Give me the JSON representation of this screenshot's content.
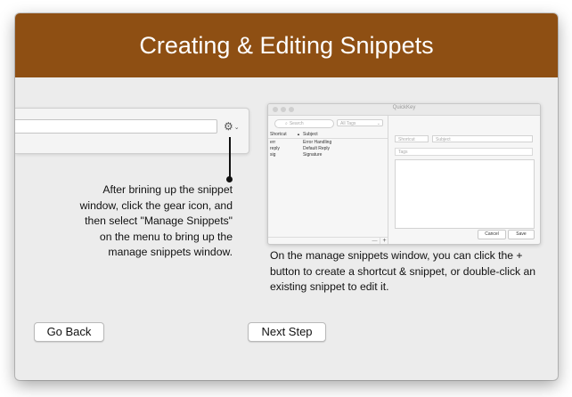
{
  "header": {
    "title": "Creating & Editing Snippets"
  },
  "left_panel": {
    "gear_icon": "gear-icon",
    "caption": "After brining up the snippet window, click the gear icon, and then select \"Manage Snippets\" on the menu to bring up the manage snippets window."
  },
  "thumbnail": {
    "window_title": "QuickKey",
    "search_placeholder": "Search",
    "tags_filter": "All Tags",
    "columns": {
      "shortcut": "Shortcut",
      "subject": "Subject"
    },
    "rows": [
      {
        "shortcut": "err",
        "subject": "Error Handling"
      },
      {
        "shortcut": "reply",
        "subject": "Default Reply"
      },
      {
        "shortcut": "sig",
        "subject": "Signature"
      }
    ],
    "shortcut_placeholder": "Shortcut",
    "subject_placeholder": "Subject",
    "tags_placeholder": "Tags",
    "cancel_label": "Cancel",
    "save_label": "Save",
    "add_symbol": "+",
    "remove_symbol": "—"
  },
  "right_panel": {
    "caption": "On the manage snippets window, you can click the + button to create a shortcut & snippet, or double-click an existing snippet to edit it."
  },
  "footer": {
    "go_back_label": "Go Back",
    "next_step_label": "Next Step"
  },
  "colors": {
    "header_bg": "#8e4f13",
    "window_bg": "#ececec"
  }
}
